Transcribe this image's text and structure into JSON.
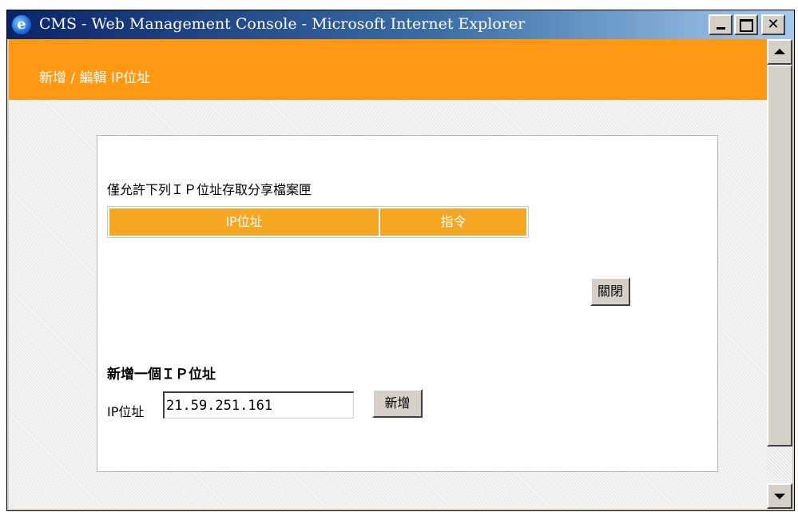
{
  "window": {
    "title": "CMS - Web Management Console - Microsoft Internet Explorer",
    "icon": "ie-icon"
  },
  "header": {
    "title": "新增 / 編輯 IP位址"
  },
  "allowed_list": {
    "label": "僅允許下列ＩＰ位址存取分享檔案匣",
    "columns": [
      "IP位址",
      "指令"
    ],
    "rows": []
  },
  "close_button_label": "關閉",
  "add_section": {
    "title": "新增一個ＩＰ位址",
    "ip_label": "IP位址",
    "ip_value": "21.59.251.161",
    "add_button_label": "新增"
  },
  "colors": {
    "header_orange": "#ff9812",
    "table_header_orange": "#f5a623",
    "titlebar_start": "#0a246a",
    "titlebar_end": "#a6caf0"
  }
}
